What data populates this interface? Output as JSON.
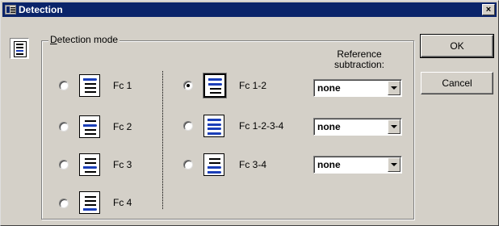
{
  "window": {
    "title": "Detection",
    "close_label": "×"
  },
  "group": {
    "label_mnemonic": "D",
    "label_rest": "etection mode"
  },
  "modes_left": [
    {
      "label": "Fc 1",
      "checked": false
    },
    {
      "label": "Fc 2",
      "checked": false
    },
    {
      "label": "Fc 3",
      "checked": false
    },
    {
      "label": "Fc 4",
      "checked": false
    }
  ],
  "modes_right": [
    {
      "label": "Fc 1-2",
      "checked": true
    },
    {
      "label": "Fc 1-2-3-4",
      "checked": false
    },
    {
      "label": "Fc 3-4",
      "checked": false
    }
  ],
  "reference": {
    "label_line1": "Reference",
    "label_line2": "subtraction:",
    "values": [
      "none",
      "none",
      "none"
    ]
  },
  "buttons": {
    "ok": "OK",
    "cancel": "Cancel"
  },
  "colors": {
    "titlebar": "#0a246a",
    "accent_blue": "#1a3eb8",
    "face": "#d4d0c8"
  }
}
